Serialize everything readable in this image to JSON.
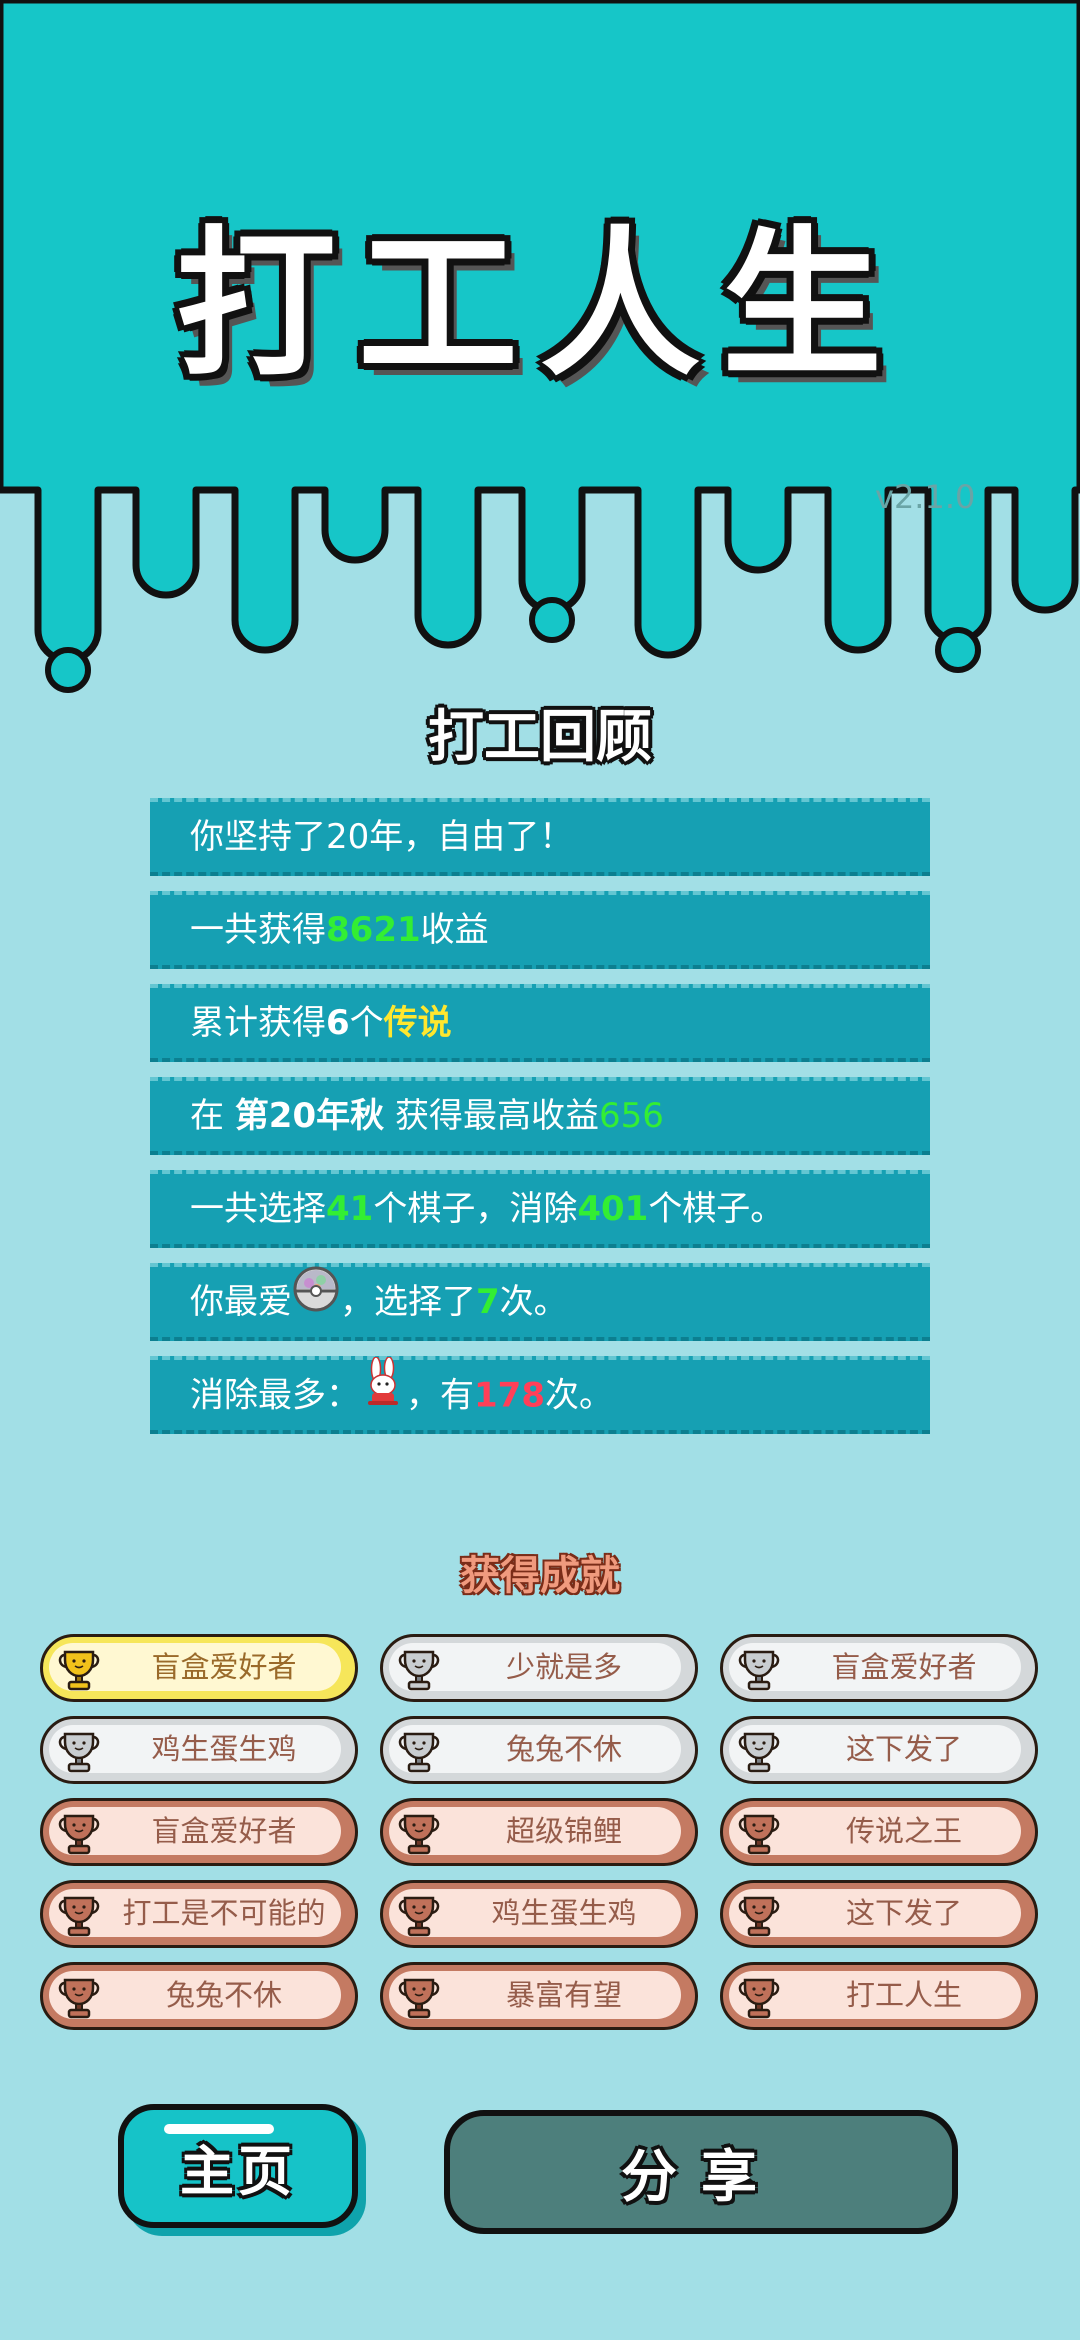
{
  "game": {
    "title": "打工人生",
    "version": "v2.1.0"
  },
  "review": {
    "title": "打工回顾",
    "row1": {
      "text": "你坚持了20年，自由了！"
    },
    "row2": {
      "pre": "一共获得",
      "earnings": "8621",
      "post": "收益"
    },
    "row3": {
      "pre": "累计获得",
      "count": "6",
      "mid": "个",
      "legend": "传说"
    },
    "row4": {
      "pre": "在 ",
      "period": "第20年秋",
      "mid": " 获得最高收益",
      "best": "656"
    },
    "row5": {
      "pre": "一共选择",
      "chosen": "41",
      "mid": "个棋子，消除",
      "removed": "401",
      "post": "个棋子。"
    },
    "row6": {
      "pre": "你最爱",
      "post1": "，选择了",
      "times": "7",
      "post2": "次。",
      "icon": "blind-box-ball-icon"
    },
    "row7": {
      "pre": "消除最多：",
      "post1": "，有",
      "times": "178",
      "post2": "次。",
      "icon": "rabbit-icon"
    }
  },
  "achievements": {
    "title": "获得成就",
    "items": [
      {
        "label": "盲盒爱好者",
        "tier": "gold"
      },
      {
        "label": "少就是多",
        "tier": "silver"
      },
      {
        "label": "盲盒爱好者",
        "tier": "silver"
      },
      {
        "label": "鸡生蛋生鸡",
        "tier": "silver"
      },
      {
        "label": "兔兔不休",
        "tier": "silver"
      },
      {
        "label": "这下发了",
        "tier": "silver"
      },
      {
        "label": "盲盒爱好者",
        "tier": "bronze"
      },
      {
        "label": "超级锦鲤",
        "tier": "bronze"
      },
      {
        "label": "传说之王",
        "tier": "bronze"
      },
      {
        "label": "打工是不可能的",
        "tier": "bronze"
      },
      {
        "label": "鸡生蛋生鸡",
        "tier": "bronze"
      },
      {
        "label": "这下发了",
        "tier": "bronze"
      },
      {
        "label": "兔兔不休",
        "tier": "bronze"
      },
      {
        "label": "暴富有望",
        "tier": "bronze"
      },
      {
        "label": "打工人生",
        "tier": "bronze"
      }
    ]
  },
  "buttons": {
    "home": "主页",
    "share": "分享"
  },
  "colors": {
    "header": "#16c6c8",
    "background": "#a2dfe6",
    "stat_row": "#16a0b3",
    "highlight_green": "#33ee33",
    "highlight_yellow": "#ffe72e",
    "highlight_red": "#ff3f58"
  }
}
